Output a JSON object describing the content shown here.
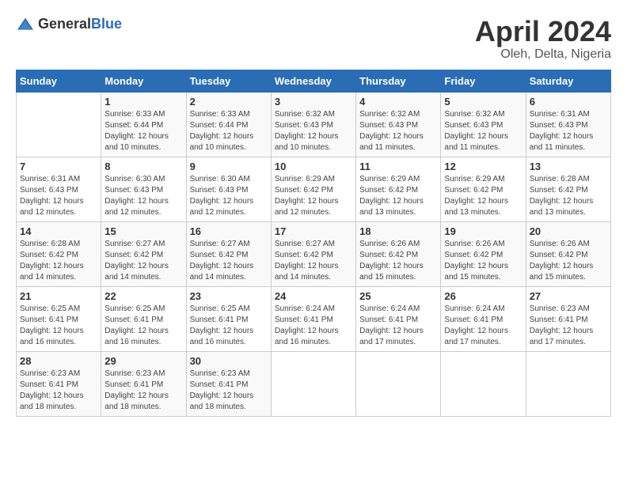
{
  "header": {
    "logo_general": "General",
    "logo_blue": "Blue",
    "title": "April 2024",
    "location": "Oleh, Delta, Nigeria"
  },
  "calendar": {
    "days_of_week": [
      "Sunday",
      "Monday",
      "Tuesday",
      "Wednesday",
      "Thursday",
      "Friday",
      "Saturday"
    ],
    "weeks": [
      [
        {
          "day": "",
          "sunrise": "",
          "sunset": "",
          "daylight": ""
        },
        {
          "day": "1",
          "sunrise": "Sunrise: 6:33 AM",
          "sunset": "Sunset: 6:44 PM",
          "daylight": "Daylight: 12 hours and 10 minutes."
        },
        {
          "day": "2",
          "sunrise": "Sunrise: 6:33 AM",
          "sunset": "Sunset: 6:44 PM",
          "daylight": "Daylight: 12 hours and 10 minutes."
        },
        {
          "day": "3",
          "sunrise": "Sunrise: 6:32 AM",
          "sunset": "Sunset: 6:43 PM",
          "daylight": "Daylight: 12 hours and 10 minutes."
        },
        {
          "day": "4",
          "sunrise": "Sunrise: 6:32 AM",
          "sunset": "Sunset: 6:43 PM",
          "daylight": "Daylight: 12 hours and 11 minutes."
        },
        {
          "day": "5",
          "sunrise": "Sunrise: 6:32 AM",
          "sunset": "Sunset: 6:43 PM",
          "daylight": "Daylight: 12 hours and 11 minutes."
        },
        {
          "day": "6",
          "sunrise": "Sunrise: 6:31 AM",
          "sunset": "Sunset: 6:43 PM",
          "daylight": "Daylight: 12 hours and 11 minutes."
        }
      ],
      [
        {
          "day": "7",
          "sunrise": "Sunrise: 6:31 AM",
          "sunset": "Sunset: 6:43 PM",
          "daylight": "Daylight: 12 hours and 12 minutes."
        },
        {
          "day": "8",
          "sunrise": "Sunrise: 6:30 AM",
          "sunset": "Sunset: 6:43 PM",
          "daylight": "Daylight: 12 hours and 12 minutes."
        },
        {
          "day": "9",
          "sunrise": "Sunrise: 6:30 AM",
          "sunset": "Sunset: 6:43 PM",
          "daylight": "Daylight: 12 hours and 12 minutes."
        },
        {
          "day": "10",
          "sunrise": "Sunrise: 6:29 AM",
          "sunset": "Sunset: 6:42 PM",
          "daylight": "Daylight: 12 hours and 12 minutes."
        },
        {
          "day": "11",
          "sunrise": "Sunrise: 6:29 AM",
          "sunset": "Sunset: 6:42 PM",
          "daylight": "Daylight: 12 hours and 13 minutes."
        },
        {
          "day": "12",
          "sunrise": "Sunrise: 6:29 AM",
          "sunset": "Sunset: 6:42 PM",
          "daylight": "Daylight: 12 hours and 13 minutes."
        },
        {
          "day": "13",
          "sunrise": "Sunrise: 6:28 AM",
          "sunset": "Sunset: 6:42 PM",
          "daylight": "Daylight: 12 hours and 13 minutes."
        }
      ],
      [
        {
          "day": "14",
          "sunrise": "Sunrise: 6:28 AM",
          "sunset": "Sunset: 6:42 PM",
          "daylight": "Daylight: 12 hours and 14 minutes."
        },
        {
          "day": "15",
          "sunrise": "Sunrise: 6:27 AM",
          "sunset": "Sunset: 6:42 PM",
          "daylight": "Daylight: 12 hours and 14 minutes."
        },
        {
          "day": "16",
          "sunrise": "Sunrise: 6:27 AM",
          "sunset": "Sunset: 6:42 PM",
          "daylight": "Daylight: 12 hours and 14 minutes."
        },
        {
          "day": "17",
          "sunrise": "Sunrise: 6:27 AM",
          "sunset": "Sunset: 6:42 PM",
          "daylight": "Daylight: 12 hours and 14 minutes."
        },
        {
          "day": "18",
          "sunrise": "Sunrise: 6:26 AM",
          "sunset": "Sunset: 6:42 PM",
          "daylight": "Daylight: 12 hours and 15 minutes."
        },
        {
          "day": "19",
          "sunrise": "Sunrise: 6:26 AM",
          "sunset": "Sunset: 6:42 PM",
          "daylight": "Daylight: 12 hours and 15 minutes."
        },
        {
          "day": "20",
          "sunrise": "Sunrise: 6:26 AM",
          "sunset": "Sunset: 6:42 PM",
          "daylight": "Daylight: 12 hours and 15 minutes."
        }
      ],
      [
        {
          "day": "21",
          "sunrise": "Sunrise: 6:25 AM",
          "sunset": "Sunset: 6:41 PM",
          "daylight": "Daylight: 12 hours and 16 minutes."
        },
        {
          "day": "22",
          "sunrise": "Sunrise: 6:25 AM",
          "sunset": "Sunset: 6:41 PM",
          "daylight": "Daylight: 12 hours and 16 minutes."
        },
        {
          "day": "23",
          "sunrise": "Sunrise: 6:25 AM",
          "sunset": "Sunset: 6:41 PM",
          "daylight": "Daylight: 12 hours and 16 minutes."
        },
        {
          "day": "24",
          "sunrise": "Sunrise: 6:24 AM",
          "sunset": "Sunset: 6:41 PM",
          "daylight": "Daylight: 12 hours and 16 minutes."
        },
        {
          "day": "25",
          "sunrise": "Sunrise: 6:24 AM",
          "sunset": "Sunset: 6:41 PM",
          "daylight": "Daylight: 12 hours and 17 minutes."
        },
        {
          "day": "26",
          "sunrise": "Sunrise: 6:24 AM",
          "sunset": "Sunset: 6:41 PM",
          "daylight": "Daylight: 12 hours and 17 minutes."
        },
        {
          "day": "27",
          "sunrise": "Sunrise: 6:23 AM",
          "sunset": "Sunset: 6:41 PM",
          "daylight": "Daylight: 12 hours and 17 minutes."
        }
      ],
      [
        {
          "day": "28",
          "sunrise": "Sunrise: 6:23 AM",
          "sunset": "Sunset: 6:41 PM",
          "daylight": "Daylight: 12 hours and 18 minutes."
        },
        {
          "day": "29",
          "sunrise": "Sunrise: 6:23 AM",
          "sunset": "Sunset: 6:41 PM",
          "daylight": "Daylight: 12 hours and 18 minutes."
        },
        {
          "day": "30",
          "sunrise": "Sunrise: 6:23 AM",
          "sunset": "Sunset: 6:41 PM",
          "daylight": "Daylight: 12 hours and 18 minutes."
        },
        {
          "day": "",
          "sunrise": "",
          "sunset": "",
          "daylight": ""
        },
        {
          "day": "",
          "sunrise": "",
          "sunset": "",
          "daylight": ""
        },
        {
          "day": "",
          "sunrise": "",
          "sunset": "",
          "daylight": ""
        },
        {
          "day": "",
          "sunrise": "",
          "sunset": "",
          "daylight": ""
        }
      ]
    ]
  }
}
